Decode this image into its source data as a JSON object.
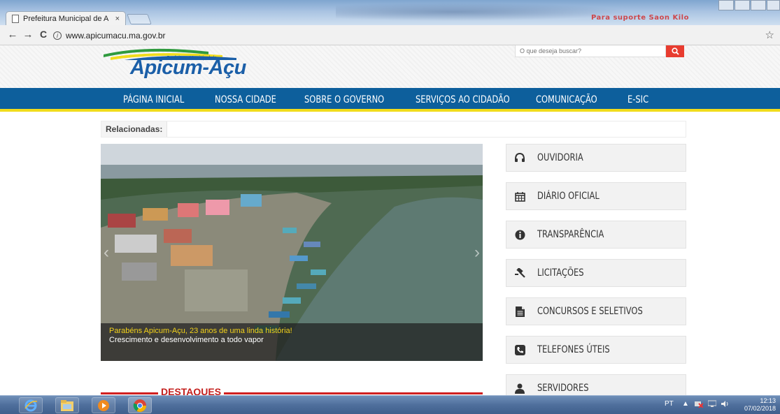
{
  "browser": {
    "tab_title": "Prefeitura Municipal de A",
    "tab_close": "×",
    "url": "www.apicumacu.ma.gov.br",
    "nav_back": "←",
    "nav_forward": "→",
    "nav_reload": "C",
    "info_icon": "i",
    "bookmark_icon": "☆",
    "background_text": "Para suporte Saon Kilo"
  },
  "header": {
    "logo_sub": "Prefeitura Municipal de",
    "logo_main": "Apicum-Açu",
    "search_placeholder": "O que deseja buscar?",
    "brand_colors": {
      "blue": "#1b5fa8",
      "green": "#2f9a3e",
      "yellow": "#f1dc1c",
      "red": "#e83c2f"
    }
  },
  "nav": {
    "items": [
      "PÁGINA INICIAL",
      "NOSSA CIDADE",
      "SOBRE O GOVERNO",
      "SERVIÇOS AO CIDADÃO",
      "COMUNICAÇÃO",
      "E-SIC"
    ],
    "color": "#0d5f9c",
    "underline_color": "#f1dc1c"
  },
  "related": {
    "label": "Relacionadas:"
  },
  "slider": {
    "caption_title": "Parabéns Apicum-Açu, 23 anos de uma linda história!",
    "caption_sub": "Crescimento e desenvolvimento a todo vapor",
    "prev": "‹",
    "next": "›"
  },
  "sidebar": {
    "items": [
      {
        "label": "OUVIDORIA",
        "icon": "headphones-icon"
      },
      {
        "label": "DIÁRIO OFICIAL",
        "icon": "calendar-icon"
      },
      {
        "label": "TRANSPARÊNCIA",
        "icon": "info-circle-icon"
      },
      {
        "label": "LICITAÇÕES",
        "icon": "gavel-icon"
      },
      {
        "label": "CONCURSOS E SELETIVOS",
        "icon": "document-icon"
      },
      {
        "label": "TELEFONES ÚTEIS",
        "icon": "phone-icon"
      },
      {
        "label": "SERVIDORES",
        "icon": "user-icon"
      }
    ]
  },
  "destaques": {
    "label": "DESTAQUES"
  },
  "taskbar": {
    "language": "PT",
    "time": "12:13",
    "date": "07/02/2018"
  }
}
